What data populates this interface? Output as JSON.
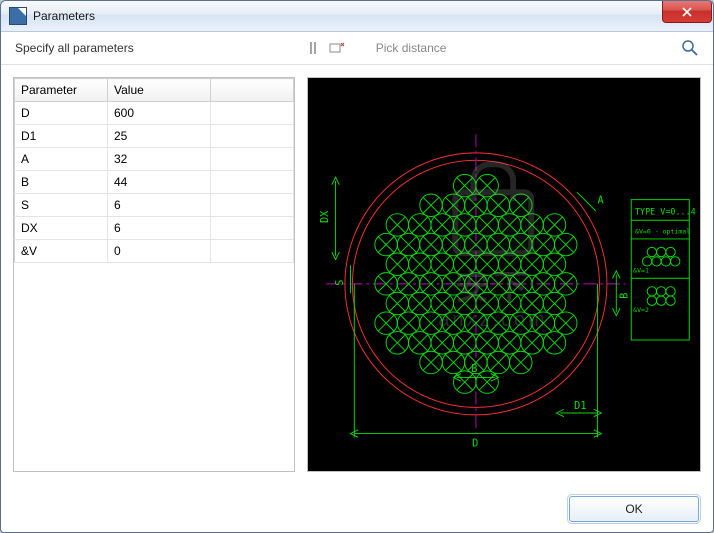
{
  "window": {
    "title": "Parameters"
  },
  "toolbar": {
    "instruction": "Specify all parameters",
    "pick_distance": "Pick distance"
  },
  "table": {
    "headers": {
      "param": "Parameter",
      "value": "Value"
    },
    "rows": [
      {
        "name": "D",
        "value": "600"
      },
      {
        "name": "D1",
        "value": "25"
      },
      {
        "name": "A",
        "value": "32"
      },
      {
        "name": "B",
        "value": "44"
      },
      {
        "name": "S",
        "value": "6"
      },
      {
        "name": "DX",
        "value": "6"
      },
      {
        "name": "&V",
        "value": "0"
      }
    ]
  },
  "legend": {
    "title": "TYPE  V=0...4",
    "row0": "&V=0 - optimal",
    "row1": "&V=1",
    "row2": "&V=2"
  },
  "dims": {
    "DX": "DX",
    "S": "S",
    "A": "A",
    "B": "B",
    "D": "D",
    "D1": "D1"
  },
  "buttons": {
    "ok": "OK"
  }
}
